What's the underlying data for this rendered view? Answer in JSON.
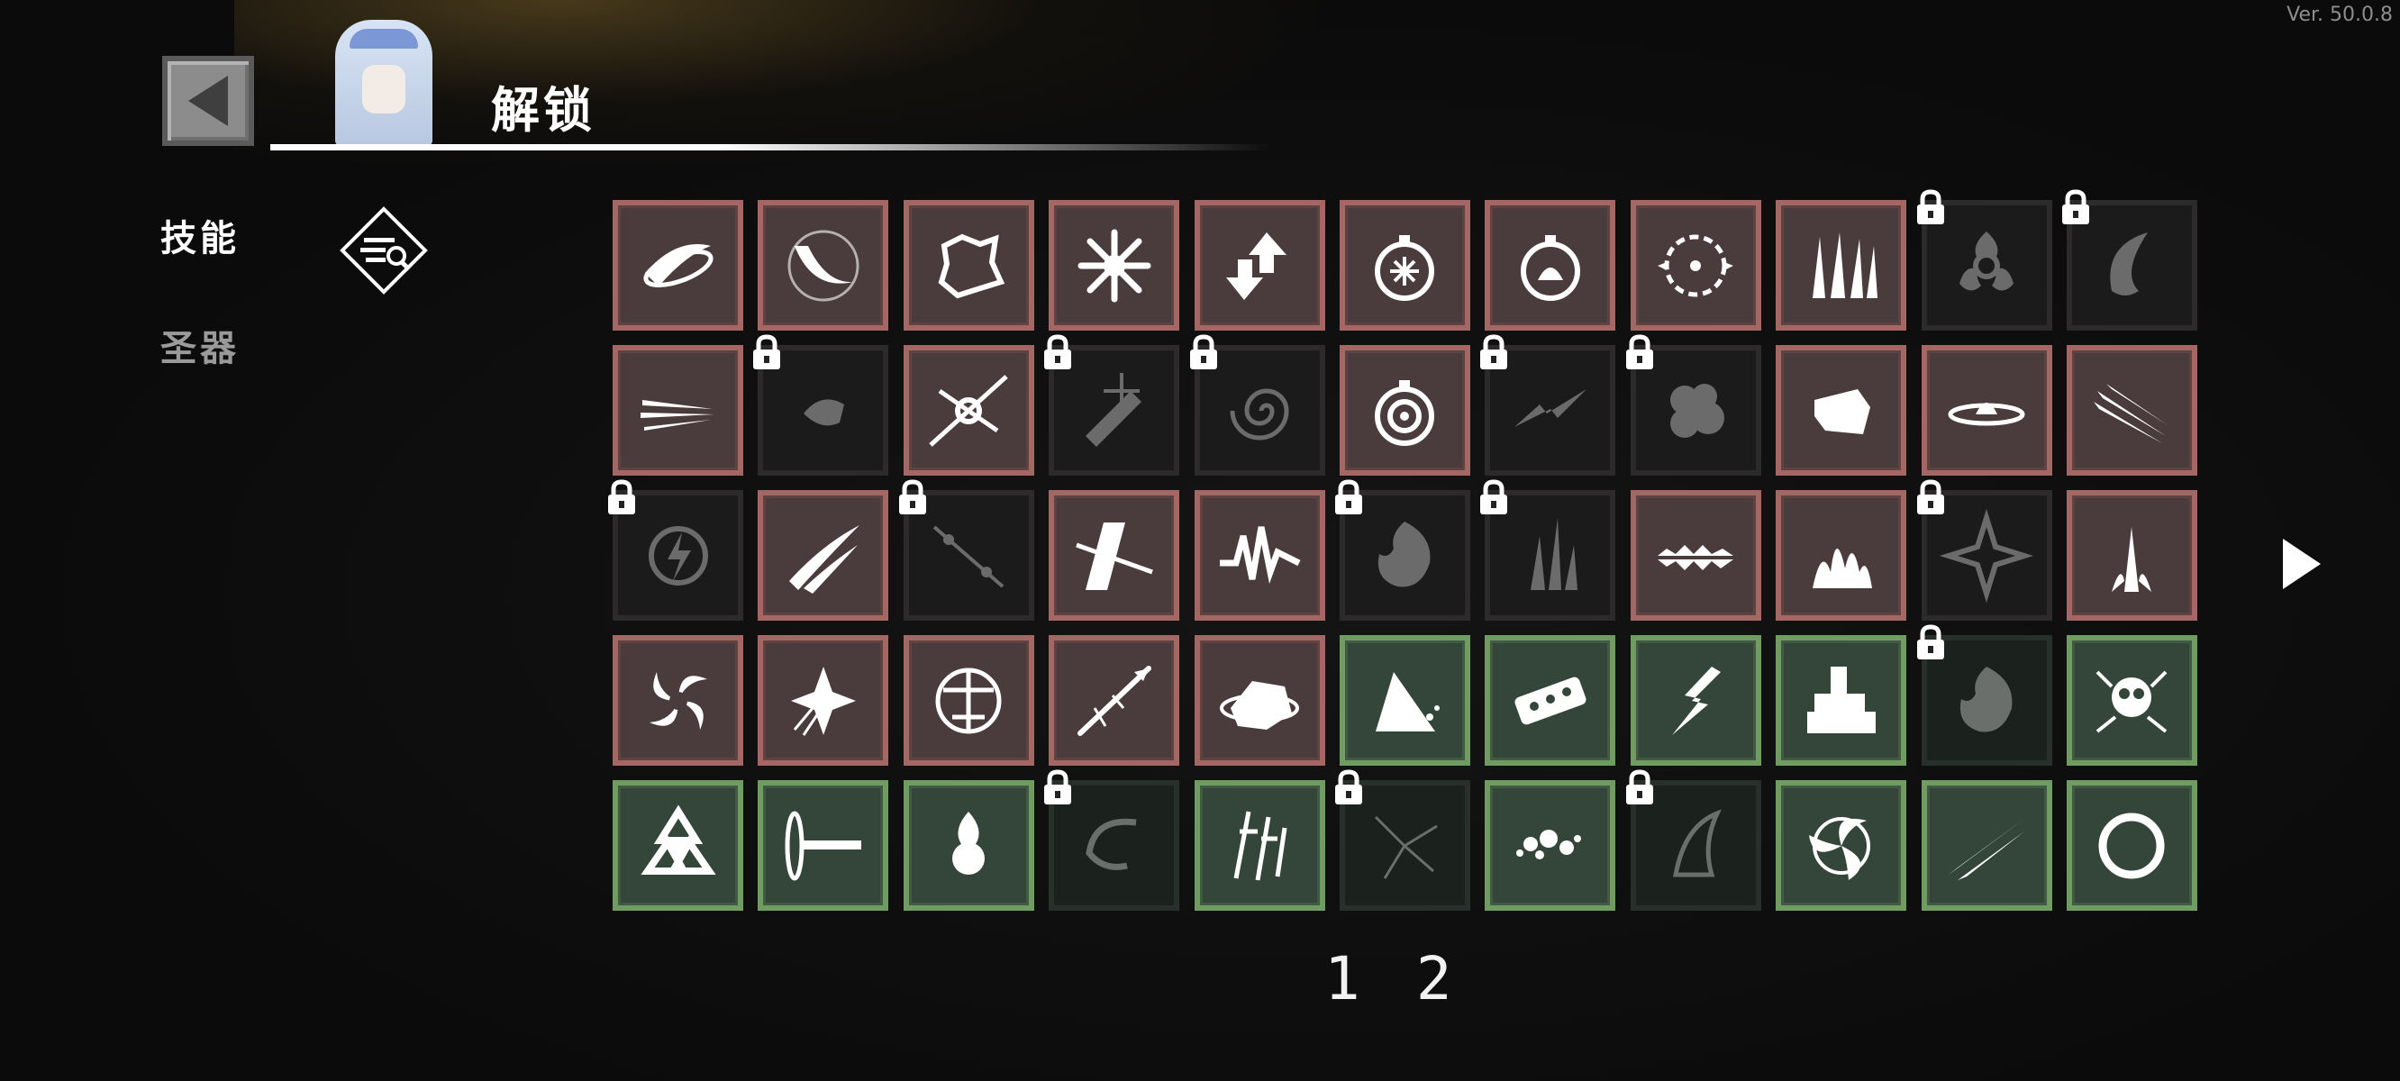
{
  "version": "Ver. 50.0.8",
  "header": {
    "title": "解锁"
  },
  "tabs": [
    {
      "label": "技能"
    },
    {
      "label": "圣器"
    }
  ],
  "filter": {
    "icon": "filter-search-icon"
  },
  "grid": {
    "rows": [
      [
        {
          "frame": "red",
          "locked": false,
          "icon": "slash-arc-icon"
        },
        {
          "frame": "red",
          "locked": false,
          "icon": "sword-swing-icon"
        },
        {
          "frame": "red",
          "locked": false,
          "icon": "splash-icon"
        },
        {
          "frame": "red",
          "locked": false,
          "icon": "starburst-icon"
        },
        {
          "frame": "red",
          "locked": false,
          "icon": "arrows-icon"
        },
        {
          "frame": "red",
          "locked": false,
          "icon": "frost-bomb-icon"
        },
        {
          "frame": "red",
          "locked": false,
          "icon": "flame-bomb-icon"
        },
        {
          "frame": "red",
          "locked": false,
          "icon": "lightning-ring-icon"
        },
        {
          "frame": "red",
          "locked": false,
          "icon": "spikes-icon"
        },
        {
          "frame": "red",
          "locked": true,
          "icon": "biohazard-burst-icon"
        },
        {
          "frame": "red",
          "locked": true,
          "icon": "crescent-icon"
        }
      ],
      [
        {
          "frame": "red",
          "locked": false,
          "icon": "claw-dash-icon"
        },
        {
          "frame": "red",
          "locked": true,
          "icon": "drone-icon"
        },
        {
          "frame": "red",
          "locked": false,
          "icon": "spark-cross-icon"
        },
        {
          "frame": "red",
          "locked": true,
          "icon": "frost-sword-icon"
        },
        {
          "frame": "red",
          "locked": true,
          "icon": "vortex-icon"
        },
        {
          "frame": "red",
          "locked": false,
          "icon": "target-bomb-icon"
        },
        {
          "frame": "red",
          "locked": true,
          "icon": "bolt-strike-icon"
        },
        {
          "frame": "red",
          "locked": true,
          "icon": "smoke-icon"
        },
        {
          "frame": "red",
          "locked": false,
          "icon": "fist-icon"
        },
        {
          "frame": "red",
          "locked": false,
          "icon": "shockwave-icon"
        },
        {
          "frame": "red",
          "locked": false,
          "icon": "triple-slash-icon"
        }
      ],
      [
        {
          "frame": "red",
          "locked": true,
          "icon": "thunder-orb-icon"
        },
        {
          "frame": "red",
          "locked": false,
          "icon": "claw-slash-icon"
        },
        {
          "frame": "red",
          "locked": true,
          "icon": "laser-icon"
        },
        {
          "frame": "red",
          "locked": false,
          "icon": "cross-slash-icon"
        },
        {
          "frame": "red",
          "locked": false,
          "icon": "pulse-wave-icon"
        },
        {
          "frame": "red",
          "locked": true,
          "icon": "fireball-icon"
        },
        {
          "frame": "red",
          "locked": true,
          "icon": "ground-spike-icon"
        },
        {
          "frame": "red",
          "locked": false,
          "icon": "jaws-icon"
        },
        {
          "frame": "red",
          "locked": false,
          "icon": "flame-pillar-icon"
        },
        {
          "frame": "red",
          "locked": true,
          "icon": "star-slash-icon"
        },
        {
          "frame": "red",
          "locked": false,
          "icon": "eruption-icon"
        }
      ],
      [
        {
          "frame": "red",
          "locked": false,
          "icon": "whirlwind-icon"
        },
        {
          "frame": "red",
          "locked": false,
          "icon": "shuriken-icon"
        },
        {
          "frame": "red",
          "locked": false,
          "icon": "crossbow-icon"
        },
        {
          "frame": "red",
          "locked": false,
          "icon": "arrow-icon"
        },
        {
          "frame": "red",
          "locked": false,
          "icon": "boulder-icon"
        },
        {
          "frame": "green",
          "locked": false,
          "icon": "impact-icon"
        },
        {
          "frame": "green",
          "locked": false,
          "icon": "dice-icon"
        },
        {
          "frame": "green",
          "locked": false,
          "icon": "chain-lightning-icon"
        },
        {
          "frame": "green",
          "locked": false,
          "icon": "turret-icon"
        },
        {
          "frame": "green",
          "locked": true,
          "icon": "flame-burst-icon"
        },
        {
          "frame": "green",
          "locked": false,
          "icon": "skull-explosion-icon"
        }
      ],
      [
        {
          "frame": "green",
          "locked": false,
          "icon": "biohazard-icon"
        },
        {
          "frame": "green",
          "locked": false,
          "icon": "blade-icon"
        },
        {
          "frame": "green",
          "locked": false,
          "icon": "potion-icon"
        },
        {
          "frame": "green",
          "locked": true,
          "icon": "hook-icon"
        },
        {
          "frame": "green",
          "locked": false,
          "icon": "daggers-icon"
        },
        {
          "frame": "green",
          "locked": true,
          "icon": "crack-icon"
        },
        {
          "frame": "green",
          "locked": false,
          "icon": "scatter-icon"
        },
        {
          "frame": "green",
          "locked": true,
          "icon": "wing-icon"
        },
        {
          "frame": "green",
          "locked": false,
          "icon": "tri-spin-icon"
        },
        {
          "frame": "green",
          "locked": false,
          "icon": "streak-icon"
        },
        {
          "frame": "green",
          "locked": false,
          "icon": "ring-icon"
        }
      ]
    ]
  },
  "pagination": {
    "pages": [
      "1",
      "2"
    ],
    "next_icon": "arrow-right-icon"
  },
  "colors": {
    "red_frame": "#a56764",
    "green_frame": "#6f9c61",
    "locked_frame": "#2c2a2a"
  }
}
